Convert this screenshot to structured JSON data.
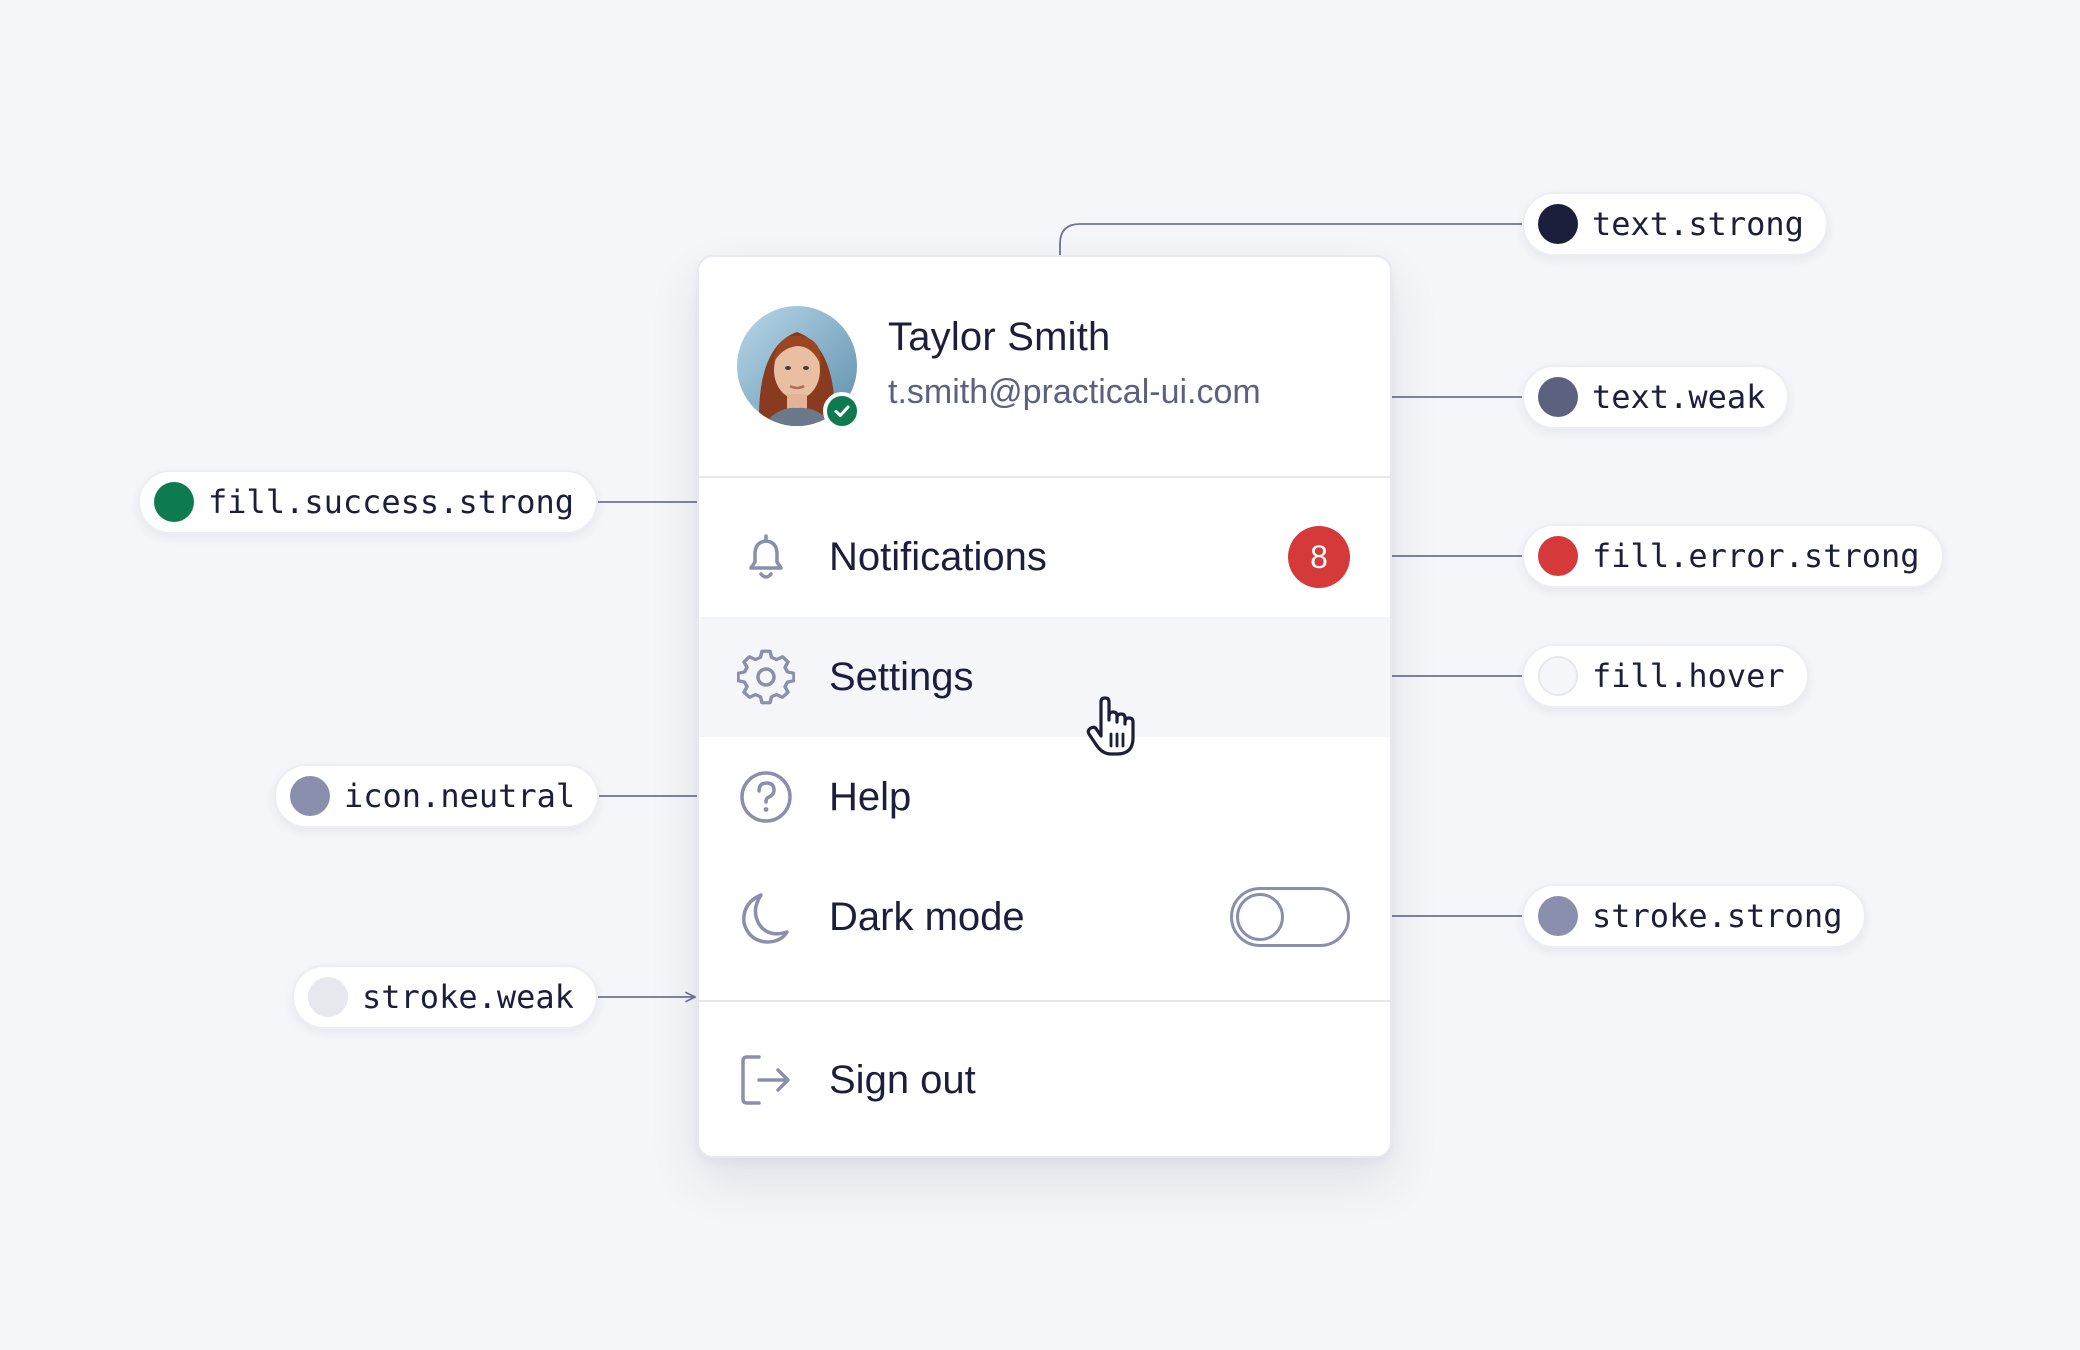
{
  "profile": {
    "name": "Taylor Smith",
    "email": "t.smith@practical-ui.com"
  },
  "menu": {
    "items": [
      {
        "label": "Notifications",
        "icon": "bell-icon",
        "badge": "8"
      },
      {
        "label": "Settings",
        "icon": "gear-icon",
        "state": "hover"
      },
      {
        "label": "Help",
        "icon": "question-circle-icon"
      },
      {
        "label": "Dark mode",
        "icon": "moon-icon",
        "toggle": "off"
      },
      {
        "label": "Sign out",
        "icon": "sign-out-icon"
      }
    ]
  },
  "annotations": [
    {
      "label": "text.strong",
      "color": "#1b1f3b"
    },
    {
      "label": "text.weak",
      "color": "#5b6280"
    },
    {
      "label": "fill.success.strong",
      "color": "#0e7a4f"
    },
    {
      "label": "fill.error.strong",
      "color": "#d63939"
    },
    {
      "label": "fill.hover",
      "color": "#f5f6f9"
    },
    {
      "label": "icon.neutral",
      "color": "#8a8fad"
    },
    {
      "label": "stroke.strong",
      "color": "#8a8fad"
    },
    {
      "label": "stroke.weak",
      "color": "#e6e8ee"
    }
  ],
  "colors": {
    "background": "#f5f6f9",
    "surface": "#ffffff",
    "text_strong": "#1b1f3b",
    "text_weak": "#5b6280",
    "success": "#0e7a4f",
    "error": "#d63939",
    "icon_neutral": "#8a8fad",
    "stroke_weak": "#e6e8ee"
  }
}
